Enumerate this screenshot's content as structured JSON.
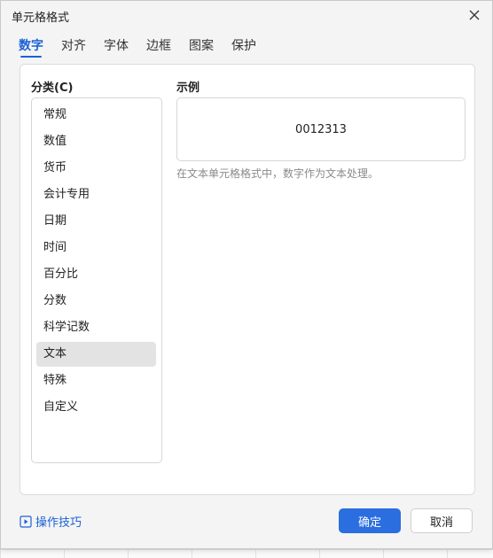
{
  "window": {
    "title": "单元格格式"
  },
  "tabs": [
    {
      "label": "数字",
      "active": true
    },
    {
      "label": "对齐",
      "active": false
    },
    {
      "label": "字体",
      "active": false
    },
    {
      "label": "边框",
      "active": false
    },
    {
      "label": "图案",
      "active": false
    },
    {
      "label": "保护",
      "active": false
    }
  ],
  "category": {
    "label": "分类(C)",
    "items": [
      {
        "label": "常规"
      },
      {
        "label": "数值"
      },
      {
        "label": "货币"
      },
      {
        "label": "会计专用"
      },
      {
        "label": "日期"
      },
      {
        "label": "时间"
      },
      {
        "label": "百分比"
      },
      {
        "label": "分数"
      },
      {
        "label": "科学记数"
      },
      {
        "label": "文本"
      },
      {
        "label": "特殊"
      },
      {
        "label": "自定义"
      }
    ],
    "selected": "文本"
  },
  "sample": {
    "label": "示例",
    "value": "0012313",
    "description": "在文本单元格格式中，数字作为文本处理。"
  },
  "footer": {
    "tips_label": "操作技巧",
    "ok_label": "确定",
    "cancel_label": "取消"
  },
  "colors": {
    "accent": "#1a62d6",
    "ok_button": "#2a6ee0",
    "selected_item": "#e3e3e3"
  },
  "icons": {
    "close": "close-icon",
    "tips": "play-square-icon"
  }
}
